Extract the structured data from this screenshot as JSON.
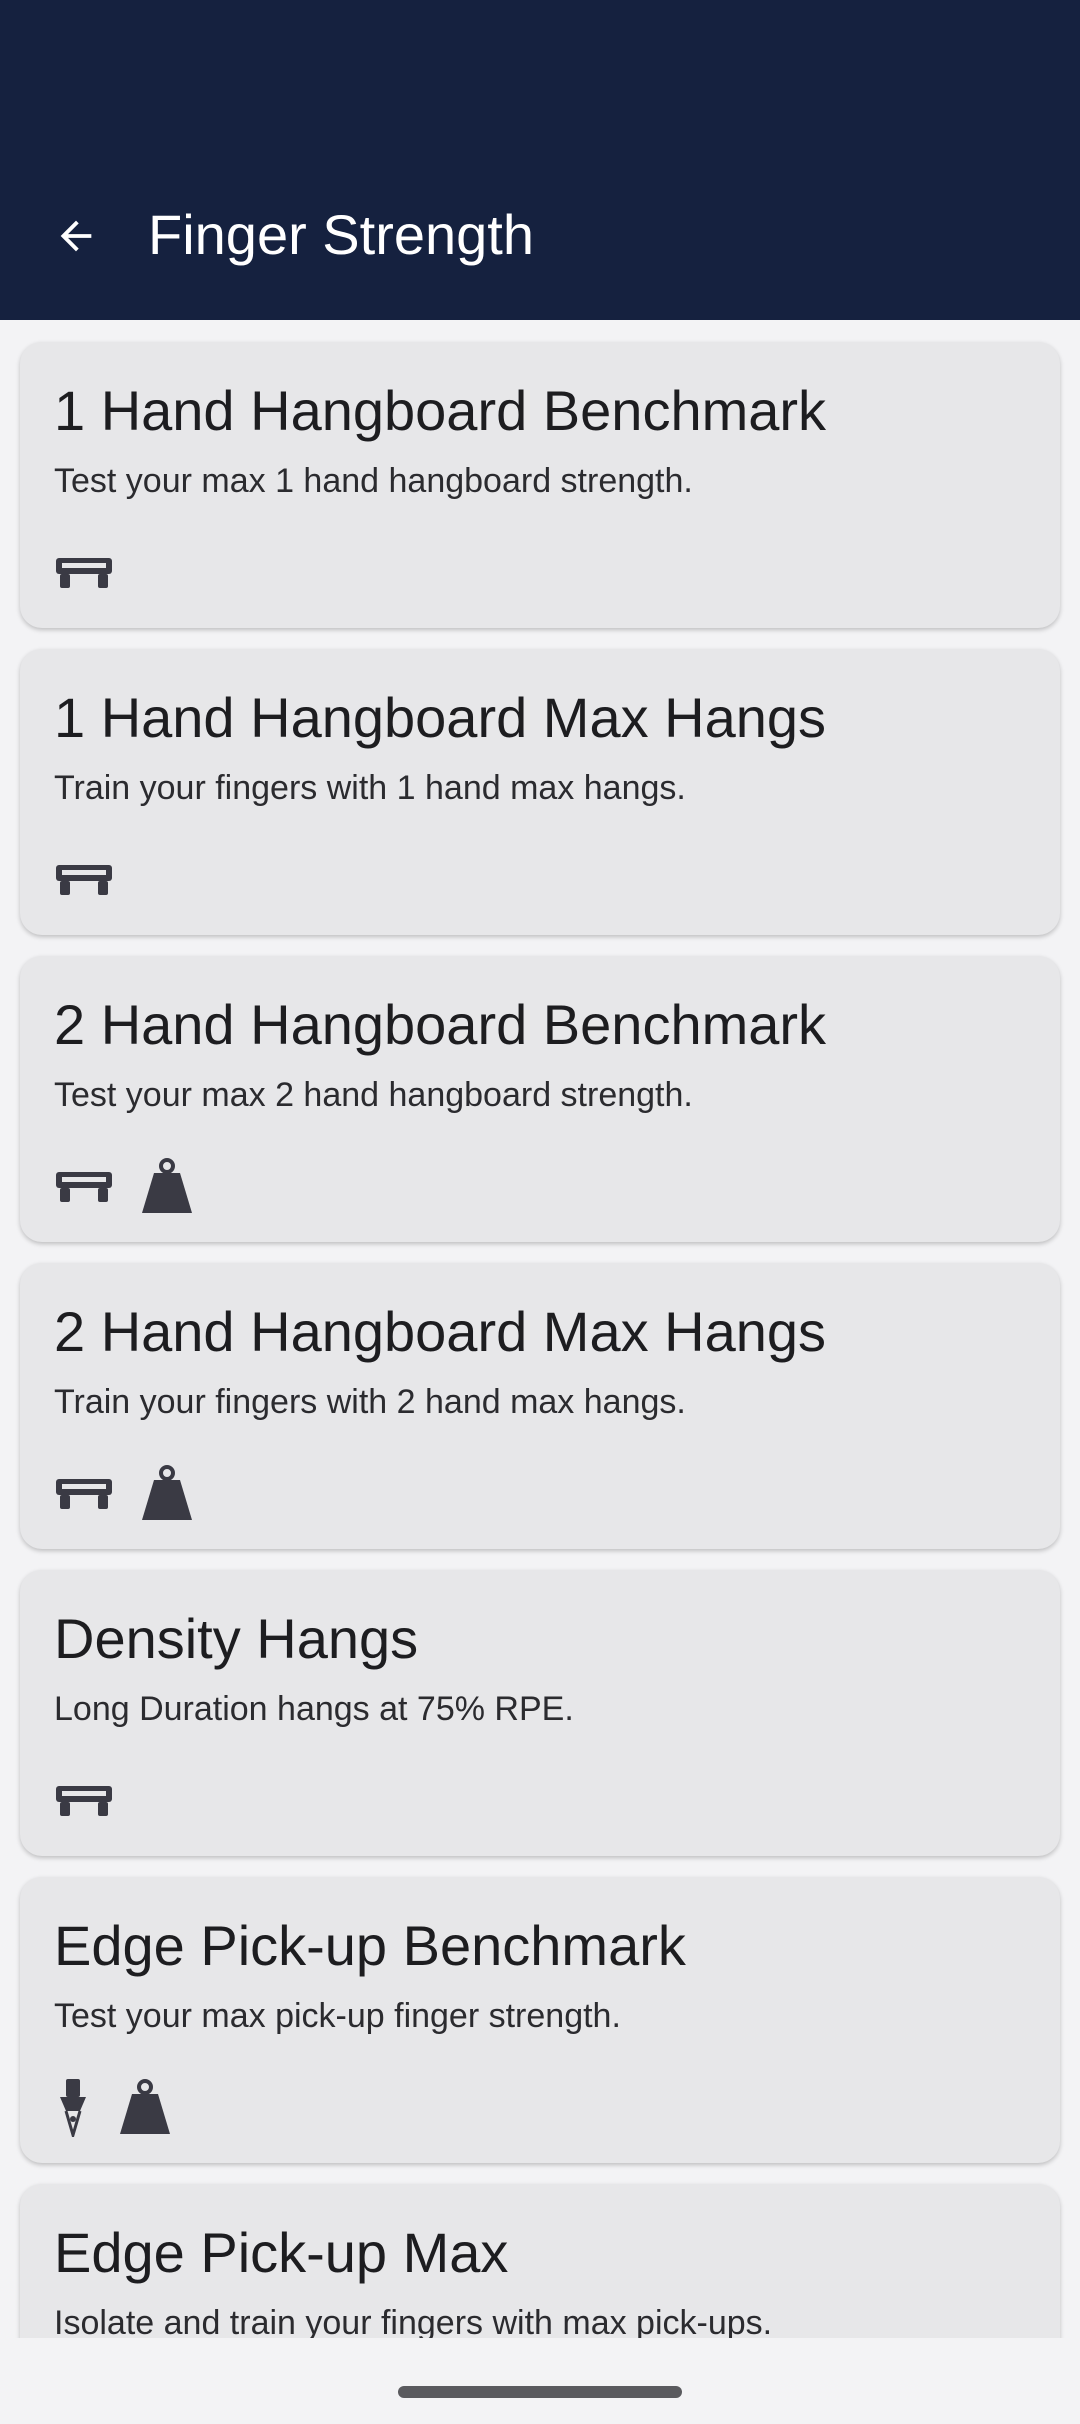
{
  "header": {
    "title": "Finger Strength"
  },
  "colors": {
    "appbar": "#15213f",
    "card": "#e7e7e9",
    "icon": "#3a3a44"
  },
  "cards": [
    {
      "title": "1 Hand Hangboard Benchmark",
      "description": "Test your max 1 hand hangboard strength.",
      "icons": [
        "hangboard-icon"
      ]
    },
    {
      "title": "1 Hand Hangboard Max Hangs",
      "description": "Train your fingers with 1 hand max hangs.",
      "icons": [
        "hangboard-icon"
      ]
    },
    {
      "title": "2 Hand Hangboard Benchmark",
      "description": "Test your max 2 hand hangboard strength.",
      "icons": [
        "hangboard-icon",
        "weight-icon"
      ]
    },
    {
      "title": "2 Hand Hangboard Max Hangs",
      "description": "Train your fingers with 2 hand max hangs.",
      "icons": [
        "hangboard-icon",
        "weight-icon"
      ]
    },
    {
      "title": "Density Hangs",
      "description": "Long Duration hangs at 75% RPE.",
      "icons": [
        "hangboard-icon"
      ]
    },
    {
      "title": "Edge Pick-up Benchmark",
      "description": "Test your max pick-up finger strength.",
      "icons": [
        "pickup-block-icon",
        "weight-icon"
      ]
    },
    {
      "title": "Edge Pick-up Max",
      "description": "Isolate and train your fingers with max pick-ups.",
      "icons": []
    }
  ]
}
